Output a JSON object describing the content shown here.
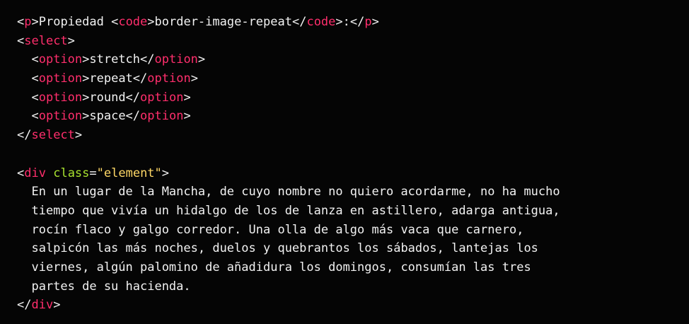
{
  "lines": [
    [
      {
        "t": "<",
        "c": "punct"
      },
      {
        "t": "p",
        "c": "tag"
      },
      {
        "t": ">Propiedad <",
        "c": "punct"
      },
      {
        "t": "code",
        "c": "tag"
      },
      {
        "t": ">border-image-repeat</",
        "c": "punct"
      },
      {
        "t": "code",
        "c": "tag"
      },
      {
        "t": ">:</",
        "c": "punct"
      },
      {
        "t": "p",
        "c": "tag"
      },
      {
        "t": ">",
        "c": "punct"
      }
    ],
    [
      {
        "t": "<",
        "c": "punct"
      },
      {
        "t": "select",
        "c": "tag"
      },
      {
        "t": ">",
        "c": "punct"
      }
    ],
    [
      {
        "t": "  <",
        "c": "punct"
      },
      {
        "t": "option",
        "c": "tag"
      },
      {
        "t": ">stretch</",
        "c": "punct"
      },
      {
        "t": "option",
        "c": "tag"
      },
      {
        "t": ">",
        "c": "punct"
      }
    ],
    [
      {
        "t": "  <",
        "c": "punct"
      },
      {
        "t": "option",
        "c": "tag"
      },
      {
        "t": ">repeat</",
        "c": "punct"
      },
      {
        "t": "option",
        "c": "tag"
      },
      {
        "t": ">",
        "c": "punct"
      }
    ],
    [
      {
        "t": "  <",
        "c": "punct"
      },
      {
        "t": "option",
        "c": "tag"
      },
      {
        "t": ">round</",
        "c": "punct"
      },
      {
        "t": "option",
        "c": "tag"
      },
      {
        "t": ">",
        "c": "punct"
      }
    ],
    [
      {
        "t": "  <",
        "c": "punct"
      },
      {
        "t": "option",
        "c": "tag"
      },
      {
        "t": ">space</",
        "c": "punct"
      },
      {
        "t": "option",
        "c": "tag"
      },
      {
        "t": ">",
        "c": "punct"
      }
    ],
    [
      {
        "t": "</",
        "c": "punct"
      },
      {
        "t": "select",
        "c": "tag"
      },
      {
        "t": ">",
        "c": "punct"
      }
    ],
    [],
    [
      {
        "t": "<",
        "c": "punct"
      },
      {
        "t": "div",
        "c": "tag"
      },
      {
        "t": " ",
        "c": "punct"
      },
      {
        "t": "class",
        "c": "attr"
      },
      {
        "t": "=",
        "c": "punct"
      },
      {
        "t": "\"element\"",
        "c": "str"
      },
      {
        "t": ">",
        "c": "punct"
      }
    ],
    [
      {
        "t": "  En un lugar de la Mancha, de cuyo nombre no quiero acordarme, no ha mucho",
        "c": "punct"
      }
    ],
    [
      {
        "t": "  tiempo que vivía un hidalgo de los de lanza en astillero, adarga antigua,",
        "c": "punct"
      }
    ],
    [
      {
        "t": "  rocín flaco y galgo corredor. Una olla de algo más vaca que carnero,",
        "c": "punct"
      }
    ],
    [
      {
        "t": "  salpicón las más noches, duelos y quebrantos los sábados, lantejas los",
        "c": "punct"
      }
    ],
    [
      {
        "t": "  viernes, algún palomino de añadidura los domingos, consumían las tres",
        "c": "punct"
      }
    ],
    [
      {
        "t": "  partes de su hacienda.",
        "c": "punct"
      }
    ],
    [
      {
        "t": "</",
        "c": "punct"
      },
      {
        "t": "div",
        "c": "tag"
      },
      {
        "t": ">",
        "c": "punct"
      }
    ]
  ]
}
